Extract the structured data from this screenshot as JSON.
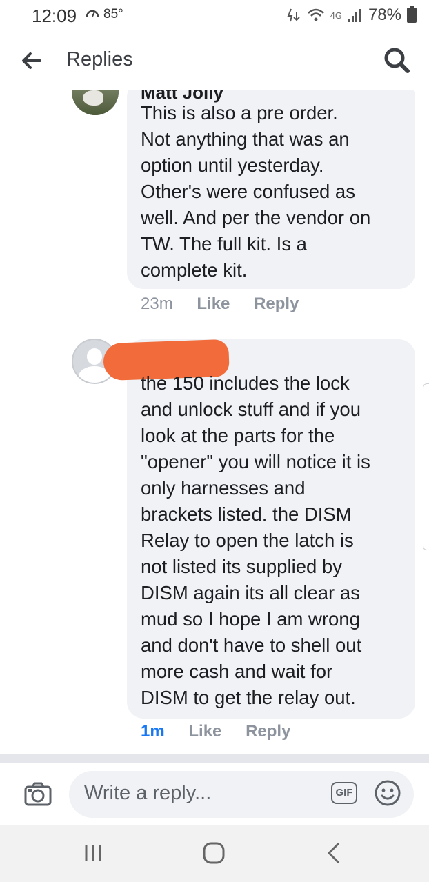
{
  "status_bar": {
    "time": "12:09",
    "temperature": "85°",
    "network": "4G",
    "battery": "78%"
  },
  "header": {
    "title": "Replies"
  },
  "comments": [
    {
      "author_partial": "Matt Jolly",
      "text": "This is also a pre order.\nNot anything that was an\noption until yesterday.\nOther's were confused as\nwell.  And per the vendor on\nTW.   The full kit. Is a\ncomplete kit.",
      "time": "23m",
      "like_label": "Like",
      "reply_label": "Reply"
    },
    {
      "text": "the 150 includes the lock\nand unlock stuff and if you\nlook at the parts for the\n\"opener\" you will notice it is\nonly harnesses and\nbrackets listed. the DISM\nRelay to open the latch is\nnot listed its supplied by\nDISM again its all clear as\nmud so I hope I am wrong\nand don't have to shell out\nmore cash and wait for\nDISM to get the relay out.",
      "time": "1m",
      "like_label": "Like",
      "reply_label": "Reply"
    }
  ],
  "composer": {
    "placeholder": "Write a reply...",
    "gif_label": "GIF"
  },
  "colors": {
    "bubble": "#f0f2f5",
    "accent": "#1877f2",
    "redaction": "#f26b3a"
  }
}
